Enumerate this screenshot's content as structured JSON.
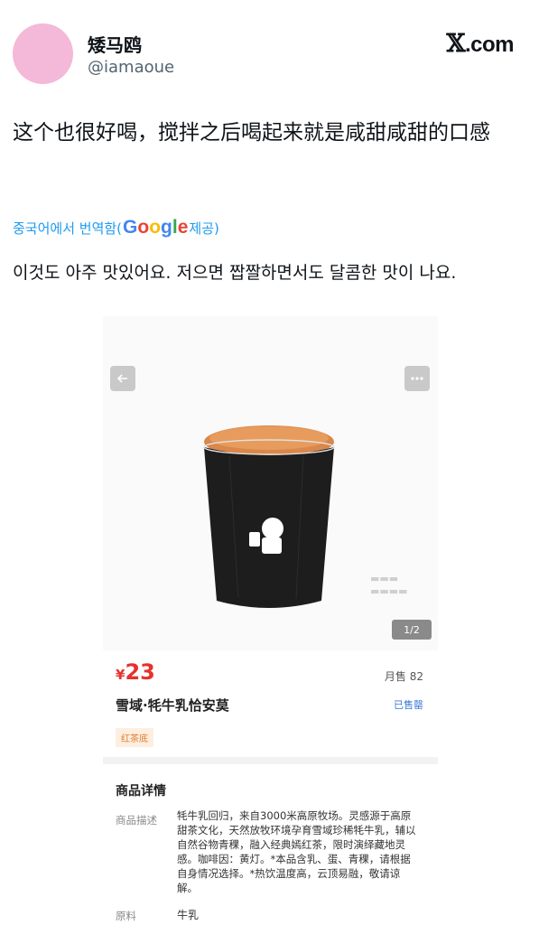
{
  "tweet": {
    "display_name": "矮马鸥",
    "handle": "@iamaoue",
    "site_logo_x": "𝕏",
    "site_logo_text": ".com",
    "text": "这个也很好喝，搅拌之后喝起来就是咸甜咸甜的口感",
    "translate_prefix": "중국어에서 번역함(",
    "google_letters": [
      "G",
      "o",
      "o",
      "g",
      "l",
      "e"
    ],
    "translate_suffix": " 제공)",
    "translated_text": "이것도 아주 맛있어요. 저으면 짭짤하면서도 달콤한 맛이 나요."
  },
  "product": {
    "back_icon": "arrow-left",
    "more_icon": "ellipsis",
    "pager": "1/2",
    "price_currency": "¥",
    "price_value": "23",
    "monthly_sales": "月售 82",
    "name": "雪域·牦牛乳恰安莫",
    "sold_status": "已售罄",
    "tag": "红茶底",
    "details_title": "商品详情",
    "desc_label": "商品描述",
    "description": "牦牛乳回归，来自3000米高原牧场。灵感源于高原甜茶文化，天然放牧环境孕育雪域珍稀牦牛乳，辅以自然谷物青稞，融入经典嫣红茶，限时演绎藏地灵感。咖啡因：黄灯。*本品含乳、蛋、青稞，请根据自身情况选择。*热饮温度高，云顶易融，敬请谅解。",
    "ingredients_label": "原料",
    "ingredients_value": "牛乳",
    "colors": {
      "price": "#e5322d",
      "tag": "#e07a2e",
      "cup": "#1d1d1d",
      "topping": "#d9874a"
    }
  }
}
